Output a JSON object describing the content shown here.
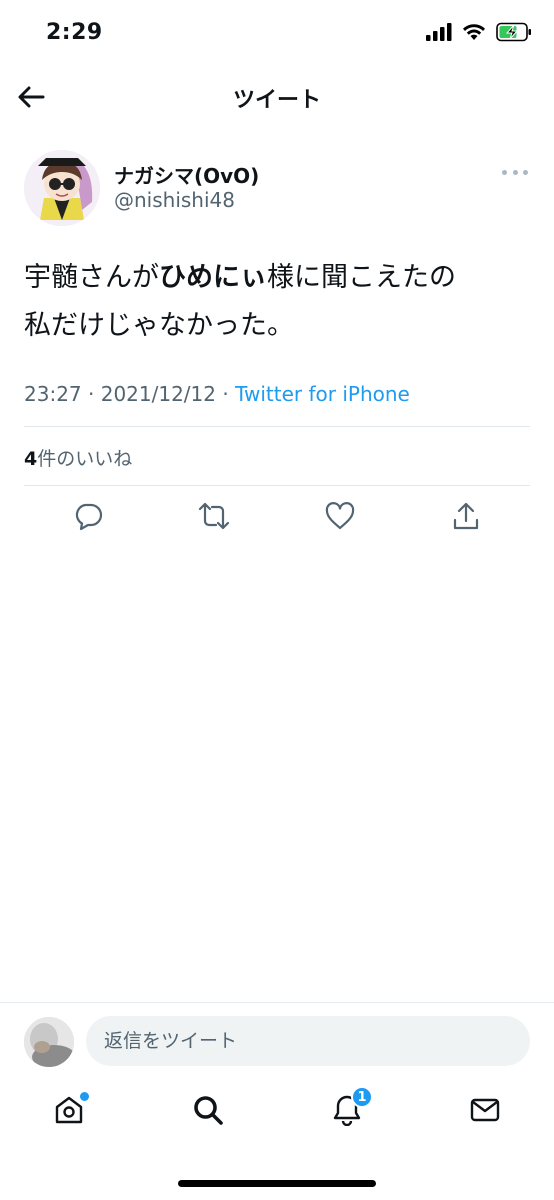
{
  "status_bar": {
    "time": "2:29",
    "icons": [
      "signal-icon",
      "wifi-icon",
      "battery-charging-icon"
    ]
  },
  "nav": {
    "back_icon": "back-arrow-icon",
    "title": "ツイート"
  },
  "tweet": {
    "author": {
      "name": "ナガシマ(OvO)",
      "handle": "@nishishi48"
    },
    "text": {
      "part1": "宇髄さんが",
      "bold": "ひめにぃ",
      "part2": "様に聞こえたの",
      "line2": "私だけじゃなかった。"
    },
    "meta": {
      "time": "23:27",
      "separator": " · ",
      "date": "2021/12/12",
      "source": "Twitter for iPhone"
    },
    "likes": {
      "count": "4",
      "label": "件のいいね"
    },
    "actions": [
      "reply-icon",
      "retweet-icon",
      "like-icon",
      "share-icon"
    ]
  },
  "reply_bar": {
    "placeholder": "返信をツイート"
  },
  "tab_bar": {
    "tabs": [
      "home-icon",
      "search-icon",
      "notifications-icon",
      "messages-icon"
    ],
    "notifications_badge": "1"
  },
  "colors": {
    "accent": "#1d9bf0",
    "text_primary": "#0f1419",
    "text_secondary": "#536471",
    "divider": "#e1e8ed",
    "input_bg": "#eff3f4"
  }
}
